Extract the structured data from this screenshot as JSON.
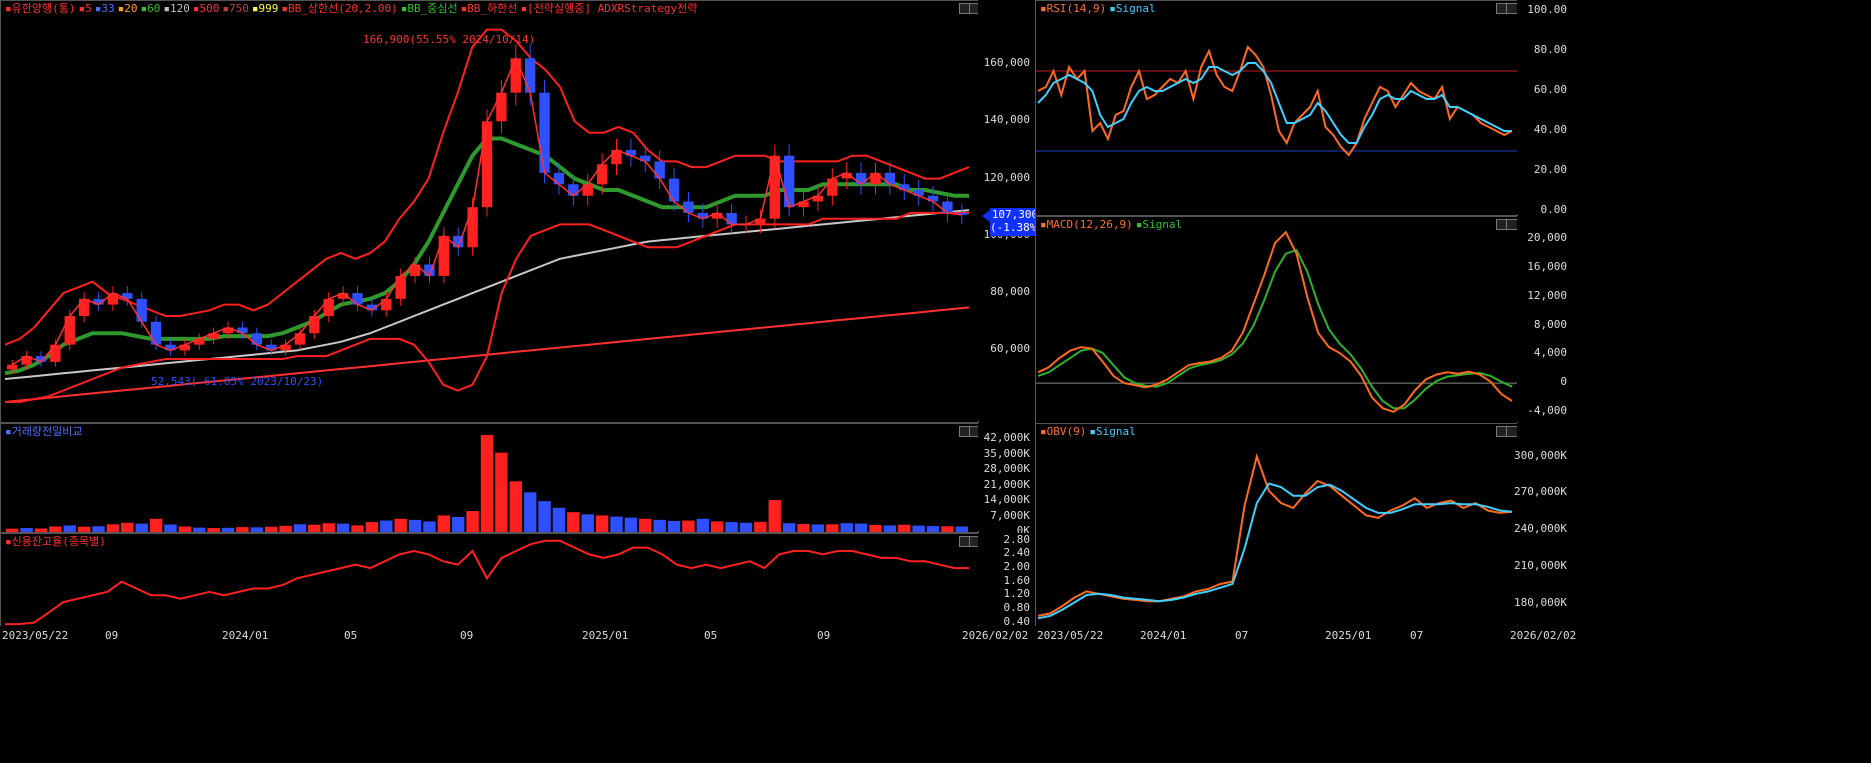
{
  "chart_data": [
    {
      "type": "candlestick",
      "panel": "price",
      "legend": [
        {
          "text": "유한양행(통)",
          "color": "#ff3030"
        },
        {
          "text": "5",
          "color": "#ff3030"
        },
        {
          "text": "33",
          "color": "#5070ff"
        },
        {
          "text": "20",
          "color": "#ffa020"
        },
        {
          "text": "60",
          "color": "#30c030"
        },
        {
          "text": "120",
          "color": "#c0c0c0"
        },
        {
          "text": "500",
          "color": "#ff3030"
        },
        {
          "text": "750",
          "color": "#c04040"
        },
        {
          "text": "999",
          "color": "#ffff40"
        },
        {
          "text": "BB_상한선(20,2.00)",
          "color": "#ff3030"
        },
        {
          "text": "BB_중심선",
          "color": "#30c030"
        },
        {
          "text": "BB_하한선",
          "color": "#ff3030"
        },
        {
          "text": "[전략실행중] ADXRStrategy전략",
          "color": "#ff3030"
        }
      ],
      "yticks": [
        60000,
        80000,
        100000,
        120000,
        140000,
        160000
      ],
      "ytick_labels": [
        "60,000",
        "80,000",
        "100,000",
        "120,000",
        "140,000",
        "160,000"
      ],
      "ylim": [
        35000,
        182000
      ],
      "current_price": "107,300",
      "current_change": "(-1.38%)",
      "annotation_high": "166,900(55.55% 2024/10/14)",
      "annotation_low": "52,543(-61.05% 2023/10/23)",
      "close_path": [
        55000,
        58000,
        56000,
        62000,
        72000,
        78000,
        76000,
        80000,
        78000,
        70000,
        62000,
        60000,
        62000,
        64000,
        66000,
        68000,
        66000,
        62000,
        60000,
        62000,
        66000,
        72000,
        78000,
        80000,
        76000,
        74000,
        78000,
        86000,
        90000,
        86000,
        100000,
        96000,
        110000,
        140000,
        150000,
        162000,
        150000,
        122000,
        118000,
        114000,
        118000,
        125000,
        130000,
        128000,
        126000,
        120000,
        112000,
        108000,
        106000,
        108000,
        104000,
        104000,
        106000,
        128000,
        110000,
        112000,
        114000,
        120000,
        122000,
        118000,
        122000,
        118000,
        116000,
        114000,
        112000,
        108000,
        107300
      ],
      "bb_upper": [
        62000,
        64000,
        68000,
        74000,
        80000,
        82000,
        84000,
        80000,
        78000,
        76000,
        74000,
        72000,
        72000,
        73000,
        74000,
        76000,
        76000,
        74000,
        76000,
        80000,
        84000,
        88000,
        92000,
        94000,
        92000,
        94000,
        98000,
        106000,
        112000,
        120000,
        136000,
        150000,
        166000,
        172000,
        172000,
        168000,
        162000,
        158000,
        152000,
        140000,
        136000,
        136000,
        138000,
        136000,
        130000,
        126000,
        126000,
        124000,
        124000,
        126000,
        128000,
        128000,
        128000,
        126000,
        126000,
        126000,
        126000,
        126000,
        128000,
        128000,
        126000,
        124000,
        122000,
        120000,
        120000,
        122000,
        124000
      ],
      "bb_middle": [
        52000,
        53000,
        55000,
        58000,
        62000,
        64000,
        66000,
        66000,
        66000,
        65000,
        64000,
        64000,
        64000,
        64000,
        64000,
        65000,
        65000,
        65000,
        65000,
        66000,
        68000,
        70000,
        73000,
        76000,
        77000,
        78000,
        80000,
        84000,
        90000,
        98000,
        108000,
        118000,
        128000,
        134000,
        134000,
        132000,
        130000,
        128000,
        124000,
        120000,
        118000,
        116000,
        116000,
        114000,
        112000,
        110000,
        110000,
        110000,
        110000,
        112000,
        114000,
        114000,
        114000,
        116000,
        116000,
        116000,
        118000,
        118000,
        118000,
        118000,
        118000,
        118000,
        116000,
        116000,
        115000,
        114000,
        114000
      ],
      "bb_lower": [
        42000,
        42000,
        43000,
        44000,
        46000,
        48000,
        50000,
        52000,
        54000,
        55000,
        56000,
        57000,
        57000,
        57000,
        57000,
        57000,
        57000,
        57000,
        57000,
        57000,
        58000,
        58000,
        58000,
        60000,
        62000,
        64000,
        64000,
        64000,
        62000,
        56000,
        48000,
        46000,
        48000,
        58000,
        80000,
        92000,
        100000,
        102000,
        104000,
        104000,
        104000,
        102000,
        100000,
        98000,
        96000,
        96000,
        96000,
        98000,
        100000,
        102000,
        104000,
        104000,
        104000,
        104000,
        104000,
        104000,
        106000,
        106000,
        106000,
        106000,
        106000,
        106000,
        108000,
        108000,
        108000,
        108000,
        108000
      ],
      "ma120": [
        50000,
        50500,
        51000,
        51500,
        52000,
        52500,
        53000,
        53500,
        54000,
        54500,
        55000,
        55500,
        56000,
        56500,
        57000,
        57500,
        58000,
        58500,
        59000,
        59500,
        60000,
        61000,
        62000,
        63000,
        64500,
        66000,
        68000,
        70000,
        72000,
        74000,
        76000,
        78000,
        80000,
        82000,
        84000,
        86000,
        88000,
        90000,
        92000,
        93000,
        94000,
        95000,
        96000,
        97000,
        98000,
        98500,
        99000,
        99500,
        100000,
        100500,
        101000,
        101500,
        102000,
        102500,
        103000,
        103500,
        104000,
        104500,
        105000,
        105500,
        106000,
        106500,
        107000,
        107500,
        108000,
        108500,
        109000
      ],
      "ma500": [
        42000,
        42500,
        43000,
        43500,
        44000,
        44500,
        45000,
        45500,
        46000,
        46500,
        47000,
        47500,
        48000,
        48500,
        49000,
        49500,
        50000,
        50500,
        51000,
        51500,
        52000,
        52500,
        53000,
        53500,
        54000,
        54500,
        55000,
        55500,
        56000,
        56500,
        57000,
        57500,
        58000,
        58500,
        59000,
        59500,
        60000,
        60500,
        61000,
        61500,
        62000,
        62500,
        63000,
        63500,
        64000,
        64500,
        65000,
        65500,
        66000,
        66500,
        67000,
        67500,
        68000,
        68500,
        69000,
        69500,
        70000,
        70500,
        71000,
        71500,
        72000,
        72500,
        73000,
        73500,
        74000,
        74500,
        75000
      ]
    },
    {
      "type": "bar",
      "panel": "volume",
      "legend": [
        {
          "text": "거래량전일비교",
          "color": "#5070ff"
        }
      ],
      "ytick_labels": [
        "0K",
        "7,000K",
        "14,000K",
        "21,000K",
        "28,000K",
        "35,000K",
        "42,000K"
      ],
      "yticks": [
        0,
        7000,
        14000,
        21000,
        28000,
        35000,
        42000
      ],
      "ylim": [
        0,
        49000
      ],
      "values": [
        1500,
        1800,
        1600,
        2500,
        3000,
        2400,
        2600,
        3500,
        4200,
        3800,
        6000,
        3400,
        2500,
        2000,
        1800,
        1900,
        2200,
        2100,
        2400,
        2800,
        3500,
        3300,
        4000,
        3800,
        3000,
        4500,
        5200,
        6000,
        5500,
        4800,
        7500,
        6800,
        9500,
        44000,
        36000,
        23000,
        18000,
        14000,
        11000,
        9000,
        8000,
        7500,
        7000,
        6500,
        6000,
        5500,
        5000,
        5200,
        6000,
        4800,
        4500,
        4200,
        4600,
        14500,
        4000,
        3600,
        3400,
        3500,
        4000,
        3800,
        3200,
        3000,
        3300,
        2900,
        2700,
        2600,
        2500
      ],
      "up": [
        1,
        0,
        1,
        1,
        0,
        1,
        0,
        1,
        1,
        0,
        1,
        0,
        1,
        0,
        1,
        0,
        1,
        0,
        1,
        1,
        0,
        1,
        1,
        0,
        1,
        1,
        0,
        1,
        0,
        0,
        1,
        0,
        1,
        1,
        1,
        1,
        0,
        0,
        0,
        1,
        0,
        1,
        0,
        0,
        1,
        0,
        0,
        1,
        0,
        1,
        0,
        0,
        1,
        1,
        0,
        1,
        0,
        1,
        0,
        0,
        1,
        0,
        1,
        0,
        0,
        1,
        0
      ]
    },
    {
      "type": "line",
      "panel": "margin",
      "legend": [
        {
          "text": "신용잔고율(종목별)",
          "color": "#ff3030"
        }
      ],
      "ytick_labels": [
        "0.40",
        "0.80",
        "1.20",
        "1.60",
        "2.00",
        "2.40",
        "2.80"
      ],
      "yticks": [
        0.4,
        0.8,
        1.2,
        1.6,
        2.0,
        2.4,
        2.8
      ],
      "ylim": [
        0.3,
        3.0
      ],
      "values": [
        0.35,
        0.36,
        0.4,
        0.7,
        1.0,
        1.1,
        1.2,
        1.3,
        1.6,
        1.4,
        1.2,
        1.2,
        1.1,
        1.2,
        1.3,
        1.2,
        1.3,
        1.4,
        1.4,
        1.5,
        1.7,
        1.8,
        1.9,
        2.0,
        2.1,
        2.0,
        2.2,
        2.4,
        2.5,
        2.4,
        2.2,
        2.1,
        2.5,
        1.7,
        2.3,
        2.5,
        2.7,
        2.8,
        2.8,
        2.6,
        2.4,
        2.3,
        2.4,
        2.6,
        2.6,
        2.4,
        2.1,
        2.0,
        2.1,
        2.0,
        2.1,
        2.2,
        2.0,
        2.4,
        2.5,
        2.5,
        2.4,
        2.5,
        2.5,
        2.4,
        2.3,
        2.3,
        2.2,
        2.2,
        2.1,
        2.0,
        2.0
      ]
    },
    {
      "type": "line",
      "panel": "rsi",
      "legend": [
        {
          "text": "RSI(14,9)",
          "color": "#ff7030"
        },
        {
          "text": "Signal",
          "color": "#40d0ff"
        }
      ],
      "ytick_labels": [
        "0.00",
        "20.00",
        "40.00",
        "60.00",
        "80.00",
        "100.00"
      ],
      "yticks": [
        0,
        20,
        40,
        60,
        80,
        100
      ],
      "ylim": [
        0,
        100
      ],
      "hlines": [
        70,
        30
      ],
      "rsi": [
        60,
        62,
        70,
        58,
        72,
        66,
        70,
        40,
        44,
        36,
        48,
        50,
        62,
        70,
        56,
        58,
        62,
        66,
        64,
        70,
        56,
        72,
        80,
        68,
        62,
        60,
        70,
        82,
        78,
        72,
        58,
        40,
        34,
        44,
        48,
        52,
        60,
        42,
        38,
        32,
        28,
        34,
        46,
        54,
        62,
        60,
        52,
        58,
        64,
        60,
        58,
        56,
        62,
        46,
        52,
        50,
        48,
        44,
        42,
        40,
        38,
        40
      ],
      "signal": [
        54,
        58,
        64,
        66,
        68,
        66,
        64,
        60,
        48,
        42,
        44,
        46,
        54,
        60,
        62,
        60,
        60,
        62,
        64,
        66,
        64,
        66,
        72,
        72,
        70,
        68,
        70,
        74,
        74,
        70,
        64,
        54,
        44,
        44,
        46,
        48,
        54,
        50,
        44,
        38,
        34,
        34,
        42,
        48,
        56,
        58,
        56,
        56,
        60,
        58,
        56,
        56,
        58,
        52,
        52,
        50,
        48,
        46,
        44,
        42,
        40,
        40
      ]
    },
    {
      "type": "line",
      "panel": "macd",
      "legend": [
        {
          "text": "MACD(12,26,9)",
          "color": "#ff7030"
        },
        {
          "text": "Signal",
          "color": "#30c030"
        }
      ],
      "ytick_labels": [
        "-4,000",
        "0",
        "4,000",
        "8,000",
        "12,000",
        "16,000",
        "20,000"
      ],
      "yticks": [
        -4000,
        0,
        4000,
        8000,
        12000,
        16000,
        20000
      ],
      "ylim": [
        -5000,
        22000
      ],
      "macd": [
        1500,
        2200,
        3500,
        4500,
        5000,
        4800,
        3000,
        1000,
        0,
        -300,
        -600,
        -200,
        500,
        1500,
        2500,
        2800,
        3000,
        3500,
        4500,
        7000,
        11000,
        15000,
        19500,
        21000,
        18000,
        12000,
        7000,
        5000,
        4200,
        3000,
        1000,
        -2000,
        -3500,
        -4000,
        -3000,
        -1000,
        500,
        1200,
        1500,
        1300,
        1600,
        1200,
        200,
        -1500,
        -2500
      ],
      "signal": [
        1000,
        1500,
        2500,
        3500,
        4500,
        4800,
        4200,
        2500,
        800,
        0,
        -400,
        -500,
        0,
        1000,
        2000,
        2500,
        2800,
        3200,
        4000,
        5500,
        8000,
        11500,
        15500,
        18000,
        18500,
        15500,
        11000,
        7500,
        5500,
        4000,
        2000,
        -500,
        -2500,
        -3500,
        -3500,
        -2300,
        -800,
        300,
        900,
        1100,
        1300,
        1400,
        1000,
        200,
        -500
      ]
    },
    {
      "type": "line",
      "panel": "obv",
      "legend": [
        {
          "text": "OBV(9)",
          "color": "#ff7030"
        },
        {
          "text": "Signal",
          "color": "#40d0ff"
        }
      ],
      "ytick_labels": [
        "180,000K",
        "210,000K",
        "240,000K",
        "270,000K",
        "300,000K"
      ],
      "yticks": [
        180000,
        210000,
        240000,
        270000,
        300000
      ],
      "ylim": [
        165000,
        320000
      ],
      "obv": [
        170000,
        172000,
        178000,
        185000,
        190000,
        188000,
        186000,
        184000,
        183000,
        182000,
        182000,
        184000,
        186000,
        190000,
        192000,
        196000,
        198000,
        260000,
        300000,
        272000,
        262000,
        258000,
        270000,
        280000,
        276000,
        268000,
        260000,
        252000,
        250000,
        256000,
        260000,
        266000,
        258000,
        262000,
        264000,
        258000,
        262000,
        256000,
        254000,
        255000
      ],
      "signal": [
        168000,
        170000,
        175000,
        181000,
        187000,
        188000,
        187000,
        185000,
        184000,
        183000,
        182000,
        183000,
        185000,
        188000,
        190000,
        193000,
        196000,
        225000,
        262000,
        278000,
        275000,
        268000,
        268000,
        275000,
        277000,
        272000,
        265000,
        258000,
        254000,
        254000,
        257000,
        261000,
        261000,
        261000,
        262000,
        261000,
        261000,
        259000,
        256000,
        255000
      ]
    }
  ],
  "x_axis_left": {
    "labels": [
      "2023/05/22",
      "09",
      "2024/01",
      "05",
      "09",
      "2025/01",
      "05",
      "09",
      "2026/02/02"
    ]
  },
  "x_axis_right": {
    "labels": [
      "2023/05/22",
      "2024/01",
      "07",
      "2025/01",
      "07",
      "2026/02/02"
    ]
  }
}
